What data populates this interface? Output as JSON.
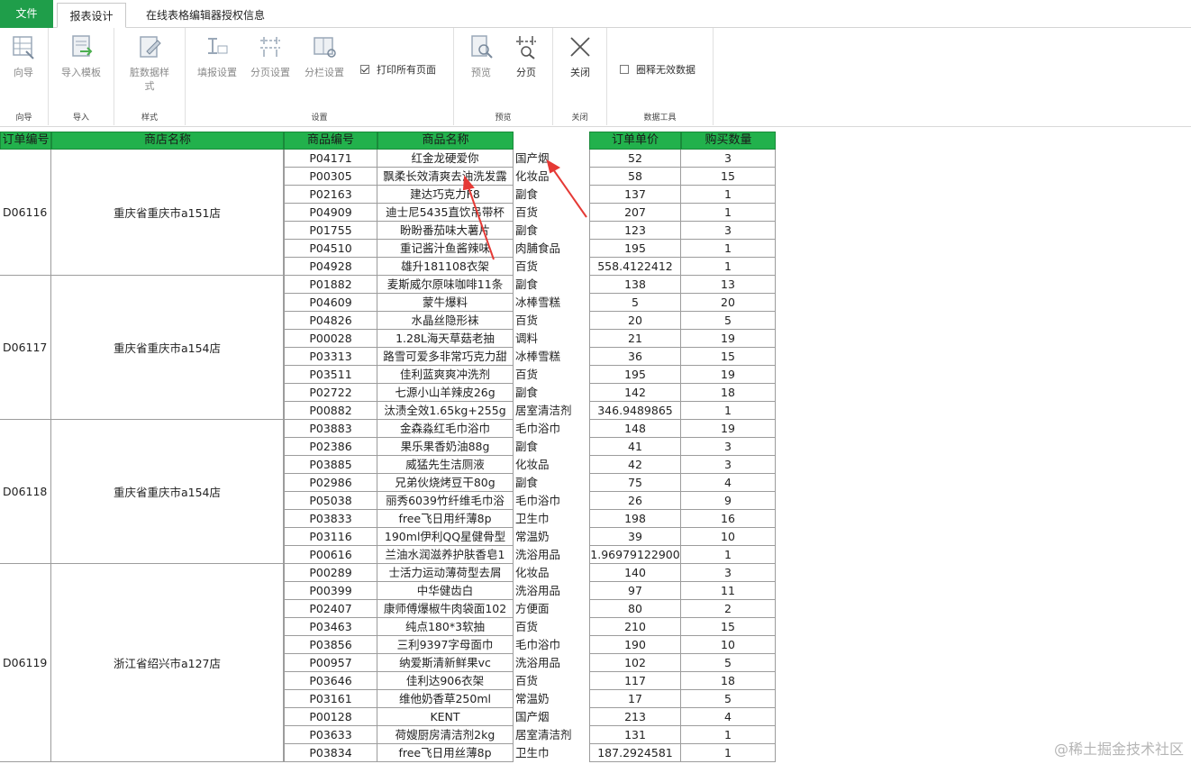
{
  "tabs": {
    "file": "文件",
    "report_design": "报表设计",
    "license": "在线表格编辑器授权信息"
  },
  "ribbon": {
    "groups": {
      "wizard": {
        "label": "向导",
        "buttons": [
          "向导"
        ]
      },
      "import": {
        "label": "导入",
        "buttons": [
          "导入模板"
        ]
      },
      "style": {
        "label": "样式",
        "buttons": [
          "脏数据样式"
        ]
      },
      "settings": {
        "label": "设置",
        "buttons": [
          "填报设置",
          "分页设置",
          "分栏设置"
        ],
        "checkbox": "打印所有页面"
      },
      "preview": {
        "label": "预览",
        "buttons": [
          "预览",
          "分页"
        ]
      },
      "close": {
        "label": "关闭",
        "buttons": [
          "关闭"
        ]
      },
      "data_tools": {
        "label": "数据工具",
        "checkbox": "圈释无效数据"
      }
    }
  },
  "table": {
    "headers": [
      "订单编号",
      "商店名称",
      "商品编号",
      "商品名称",
      "订单单价",
      "购买数量"
    ],
    "groups": [
      {
        "order": "D06116",
        "shop": "重庆省重庆市a151店",
        "rows": [
          [
            "P04171",
            "红金龙硬爱你",
            "国产烟",
            "52",
            "3"
          ],
          [
            "P00305",
            "飘柔长效清爽去油洗发露",
            "化妆品",
            "58",
            "15"
          ],
          [
            "P02163",
            "建达巧克力F8",
            "副食",
            "137",
            "1"
          ],
          [
            "P04909",
            "迪士尼5435直饮吊带杯",
            "百货",
            "207",
            "1"
          ],
          [
            "P01755",
            "盼盼番茄味大薯片",
            "副食",
            "123",
            "3"
          ],
          [
            "P04510",
            "重记酱汁鱼酱辣味",
            "肉脯食品",
            "195",
            "1"
          ],
          [
            "P04928",
            "雄升181108衣架",
            "百货",
            "558.4122412",
            "1"
          ]
        ]
      },
      {
        "order": "D06117",
        "shop": "重庆省重庆市a154店",
        "rows": [
          [
            "P01882",
            "麦斯威尔原味咖啡11条",
            "副食",
            "138",
            "13"
          ],
          [
            "P04609",
            "蒙牛爆料",
            "冰棒雪糕",
            "5",
            "20"
          ],
          [
            "P04826",
            "水晶丝隐形袜",
            "百货",
            "20",
            "5"
          ],
          [
            "P00028",
            "1.28L海天草菇老抽",
            "调料",
            "21",
            "19"
          ],
          [
            "P03313",
            "路雪可爱多非常巧克力甜",
            "冰棒雪糕",
            "36",
            "15"
          ],
          [
            "P03511",
            "佳利蓝爽爽冲洗剂",
            "百货",
            "195",
            "19"
          ],
          [
            "P02722",
            "七源小山羊辣皮26g",
            "副食",
            "142",
            "18"
          ],
          [
            "P00882",
            "汰渍全效1.65kg+255g",
            "居室清洁剂",
            "346.9489865",
            "1"
          ]
        ]
      },
      {
        "order": "D06118",
        "shop": "重庆省重庆市a154店",
        "rows": [
          [
            "P03883",
            "金森淼红毛巾浴巾",
            "毛巾浴巾",
            "148",
            "19"
          ],
          [
            "P02386",
            "果乐果香奶油88g",
            "副食",
            "41",
            "3"
          ],
          [
            "P03885",
            "威猛先生洁厕液",
            "化妆品",
            "42",
            "3"
          ],
          [
            "P02986",
            "兄弟伙烧烤豆干80g",
            "副食",
            "75",
            "4"
          ],
          [
            "P05038",
            "丽秀6039竹纤维毛巾浴",
            "毛巾浴巾",
            "26",
            "9"
          ],
          [
            "P03833",
            "free飞日用纤薄8p",
            "卫生巾",
            "198",
            "16"
          ],
          [
            "P03116",
            "190ml伊利QQ星健骨型",
            "常温奶",
            "39",
            "10"
          ],
          [
            "P00616",
            "兰油水润滋养护肤香皂1",
            "洗浴用品",
            "1.96979122900",
            "1"
          ]
        ]
      },
      {
        "order": "D06119",
        "shop": "浙江省绍兴市a127店",
        "rows": [
          [
            "P00289",
            "士活力运动薄荷型去屑",
            "化妆品",
            "140",
            "3"
          ],
          [
            "P00399",
            "中华健齿白",
            "洗浴用品",
            "97",
            "11"
          ],
          [
            "P02407",
            "康师傅爆椒牛肉袋面102",
            "方便面",
            "80",
            "2"
          ],
          [
            "P03463",
            "纯点180*3软抽",
            "百货",
            "210",
            "15"
          ],
          [
            "P03856",
            "三利9397字母面巾",
            "毛巾浴巾",
            "190",
            "10"
          ],
          [
            "P00957",
            "纳爱斯清新鲜果vc",
            "洗浴用品",
            "102",
            "5"
          ],
          [
            "P03646",
            "佳利达906衣架",
            "百货",
            "117",
            "18"
          ],
          [
            "P03161",
            "维他奶香草250ml",
            "常温奶",
            "17",
            "5"
          ],
          [
            "P00128",
            "KENT",
            "国产烟",
            "213",
            "4"
          ],
          [
            "P03633",
            "荷嫂厨房清洁剂2kg",
            "居室清洁剂",
            "131",
            "1"
          ],
          [
            "P03834",
            "free飞日用丝薄8p",
            "卫生巾",
            "187.2924581",
            "1"
          ]
        ]
      }
    ]
  },
  "watermark": "@稀土掘金技术社区",
  "colors": {
    "header_green": "#22b14c",
    "file_tab": "#1f9e4a",
    "arrow": "#e53935"
  }
}
